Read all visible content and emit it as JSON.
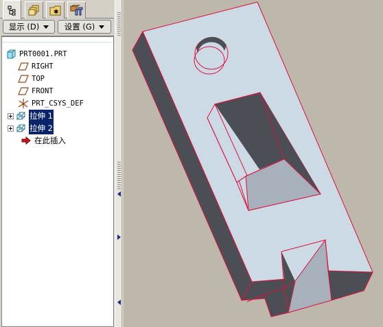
{
  "toolbar": {
    "tabs": [
      {
        "icon": "model-tree-icon"
      },
      {
        "icon": "folder-browser-icon"
      },
      {
        "icon": "favorites-icon"
      },
      {
        "icon": "connections-icon"
      }
    ],
    "show_label": "显示 (D)",
    "settings_label": "设置 (G)"
  },
  "tree": {
    "root": "PRT0001.PRT",
    "items": [
      {
        "label": "RIGHT",
        "icon": "datum-plane-icon"
      },
      {
        "label": "TOP",
        "icon": "datum-plane-icon"
      },
      {
        "label": "FRONT",
        "icon": "datum-plane-icon"
      },
      {
        "label": "PRT_CSYS_DEF",
        "icon": "coordinate-system-icon"
      },
      {
        "label": "拉伸 1",
        "icon": "extrude-icon",
        "selected": true
      },
      {
        "label": "拉伸 2",
        "icon": "extrude-icon",
        "selected": true
      },
      {
        "label": "在此插入",
        "icon": "insert-here-arrow-icon"
      }
    ]
  },
  "colors": {
    "panel_bg": "#d4d0c8",
    "viewport_bg": "#bdb8ab",
    "part_top": "#ccdae5",
    "part_side": "#4b4f55",
    "pocket_floor": "#a6b1bb",
    "edge_highlight": "#e0103a",
    "selection": "#0a246a"
  }
}
